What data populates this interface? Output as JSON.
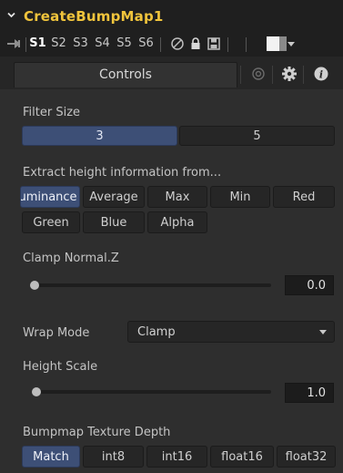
{
  "header": {
    "tool_name": "CreateBumpMap1"
  },
  "versions": {
    "labels": [
      "S1",
      "S2",
      "S3",
      "S4",
      "S5",
      "S6"
    ],
    "active_index": 0
  },
  "tabs": {
    "controls_label": "Controls"
  },
  "filter_size": {
    "label": "Filter Size",
    "options": [
      "3",
      "5"
    ],
    "selected": "3"
  },
  "extract": {
    "label": "Extract height information from...",
    "options": [
      "Luminance",
      "Average",
      "Max",
      "Min",
      "Red",
      "Green",
      "Blue",
      "Alpha"
    ],
    "selected": "Luminance"
  },
  "clamp": {
    "label": "Clamp Normal.Z",
    "value": "0.0"
  },
  "wrap_mode": {
    "label": "Wrap Mode",
    "value": "Clamp"
  },
  "height_scale": {
    "label": "Height Scale",
    "value": "1.0"
  },
  "texture_depth": {
    "label": "Bumpmap Texture Depth",
    "options": [
      "Match",
      "int8",
      "int16",
      "float16",
      "float32"
    ],
    "selected": "Match"
  },
  "colors": {
    "accent": "#3d4f76",
    "title": "#f0c43c",
    "background": "#2b2b2b"
  }
}
